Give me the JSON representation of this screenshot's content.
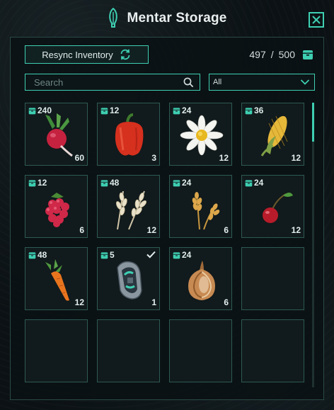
{
  "window": {
    "title": "Mentar Storage"
  },
  "toolbar": {
    "resync_label": "Resync Inventory"
  },
  "capacity": {
    "used": "497",
    "separator": "/",
    "max": "500"
  },
  "search": {
    "placeholder": "Search",
    "value": ""
  },
  "filter": {
    "selected": "All"
  },
  "accent_color": "#3ecfb2",
  "slots": [
    {
      "item": "radish",
      "top_qty": "240",
      "bottom_qty": "60",
      "checked": false
    },
    {
      "item": "red-bell-pepper",
      "top_qty": "12",
      "bottom_qty": "3",
      "checked": false
    },
    {
      "item": "daisy-flower",
      "top_qty": "24",
      "bottom_qty": "12",
      "checked": false
    },
    {
      "item": "corn",
      "top_qty": "36",
      "bottom_qty": "12",
      "checked": false
    },
    {
      "item": "raspberry",
      "top_qty": "12",
      "bottom_qty": "6",
      "checked": false
    },
    {
      "item": "oat-wheat",
      "top_qty": "48",
      "bottom_qty": "12",
      "checked": false
    },
    {
      "item": "wheat",
      "top_qty": "24",
      "bottom_qty": "6",
      "checked": false
    },
    {
      "item": "cherry",
      "top_qty": "24",
      "bottom_qty": "12",
      "checked": false
    },
    {
      "item": "carrot",
      "top_qty": "48",
      "bottom_qty": "12",
      "checked": false
    },
    {
      "item": "tech-module",
      "top_qty": "5",
      "bottom_qty": "1",
      "checked": true
    },
    {
      "item": "onion",
      "top_qty": "24",
      "bottom_qty": "6",
      "checked": false
    },
    {
      "item": "empty",
      "top_qty": "",
      "bottom_qty": "",
      "checked": false
    },
    {
      "item": "empty",
      "top_qty": "",
      "bottom_qty": "",
      "checked": false
    },
    {
      "item": "empty",
      "top_qty": "",
      "bottom_qty": "",
      "checked": false
    },
    {
      "item": "empty",
      "top_qty": "",
      "bottom_qty": "",
      "checked": false
    },
    {
      "item": "empty",
      "top_qty": "",
      "bottom_qty": "",
      "checked": false
    }
  ]
}
